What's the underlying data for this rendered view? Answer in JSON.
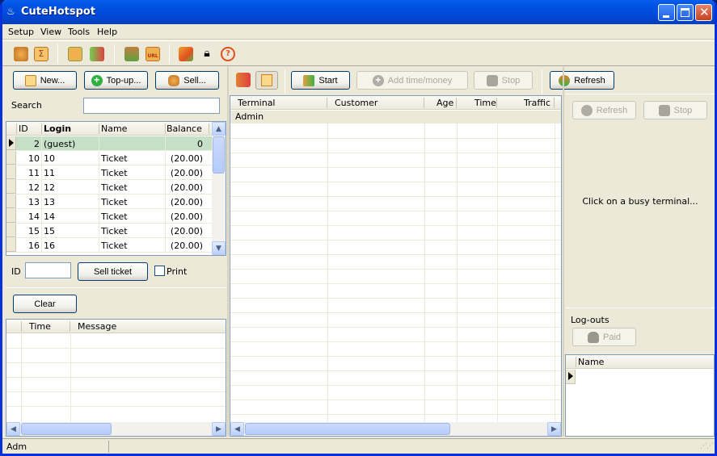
{
  "window": {
    "title": "CuteHotspot"
  },
  "menu": [
    "Setup",
    "View",
    "Tools",
    "Help"
  ],
  "toolbar_icons": [
    "burger-icon",
    "sum-report-icon",
    "price-tag-icon",
    "tickets-icon",
    "users-icon",
    "url-icon",
    "checklist-icon",
    "lock-icon",
    "help-icon"
  ],
  "left": {
    "buttons": {
      "new": "New...",
      "topup": "Top-up...",
      "sell": "Sell..."
    },
    "search_label": "Search",
    "search_value": "",
    "accounts": {
      "columns": [
        "ID",
        "Login",
        "Name",
        "Balance"
      ],
      "rows": [
        {
          "id": "2",
          "login": "(guest)",
          "name": "",
          "balance": "0"
        },
        {
          "id": "10",
          "login": "10",
          "name": "Ticket",
          "balance": "(20.00)"
        },
        {
          "id": "11",
          "login": "11",
          "name": "Ticket",
          "balance": "(20.00)"
        },
        {
          "id": "12",
          "login": "12",
          "name": "Ticket",
          "balance": "(20.00)"
        },
        {
          "id": "13",
          "login": "13",
          "name": "Ticket",
          "balance": "(20.00)"
        },
        {
          "id": "14",
          "login": "14",
          "name": "Ticket",
          "balance": "(20.00)"
        },
        {
          "id": "15",
          "login": "15",
          "name": "Ticket",
          "balance": "(20.00)"
        },
        {
          "id": "16",
          "login": "16",
          "name": "Ticket",
          "balance": "(20.00)"
        }
      ]
    },
    "id_label": "ID",
    "id_value": "",
    "sell_ticket": "Sell ticket",
    "print_label": "Print",
    "print_checked": false,
    "clear": "Clear",
    "log": {
      "columns": [
        "Time",
        "Message"
      ]
    }
  },
  "center": {
    "buttons": {
      "start": "Start",
      "add": "Add time/money",
      "stop": "Stop",
      "refresh": "Refresh"
    },
    "terminals": {
      "columns": [
        "Terminal",
        "Customer",
        "Age",
        "Time",
        "Traffic"
      ],
      "rows": [
        {
          "terminal": "Admin"
        }
      ]
    }
  },
  "right": {
    "refresh": "Refresh",
    "stop": "Stop",
    "hint": "Click on a busy terminal...",
    "logouts_label": "Log-outs",
    "paid": "Paid",
    "logouts": {
      "columns": [
        "Name"
      ]
    }
  },
  "status": {
    "user": "Adm"
  }
}
